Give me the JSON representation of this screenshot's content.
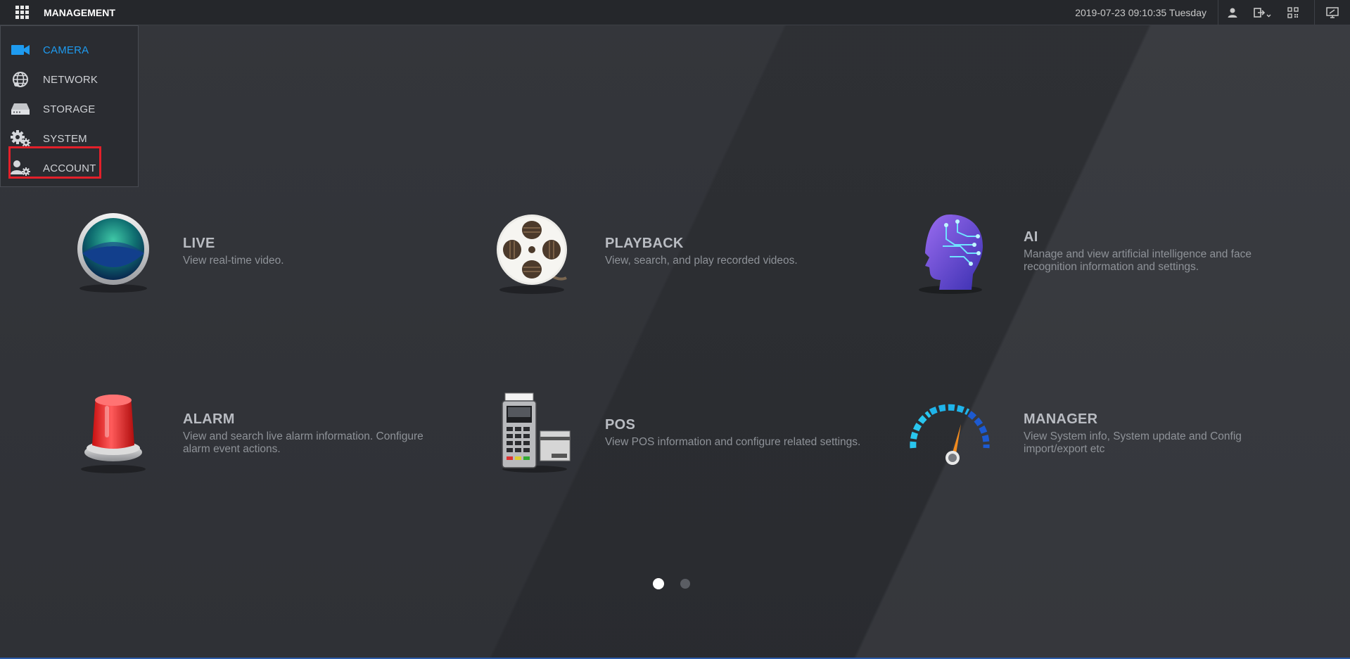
{
  "header": {
    "title": "MANAGEMENT",
    "datetime": "2019-07-23 09:10:35 Tuesday",
    "icons": [
      "grid-menu-icon",
      "user-icon",
      "logout-icon",
      "qr-code-icon",
      "monitor-icon"
    ]
  },
  "menu": {
    "items": [
      {
        "label": "CAMERA",
        "icon": "camera-icon",
        "active": true
      },
      {
        "label": "NETWORK",
        "icon": "network-globe-icon",
        "active": false
      },
      {
        "label": "STORAGE",
        "icon": "hard-drive-icon",
        "active": false
      },
      {
        "label": "SYSTEM",
        "icon": "gears-icon",
        "active": false,
        "highlighted": true
      },
      {
        "label": "ACCOUNT",
        "icon": "user-gear-icon",
        "active": false
      }
    ],
    "active_color": "#1e9bf0",
    "highlight_color": "#e3202a"
  },
  "tiles": [
    {
      "title": "LIVE",
      "description": "View real-time video.",
      "icon": "live-lens-icon"
    },
    {
      "title": "PLAYBACK",
      "description": "View, search, and play recorded videos.",
      "icon": "film-reel-icon"
    },
    {
      "title": "AI",
      "description": "Manage and view artificial intelligence and face recognition information and settings.",
      "icon": "ai-head-icon"
    },
    {
      "title": "ALARM",
      "description": "View and search live alarm information. Configure alarm event actions.",
      "icon": "alarm-siren-icon"
    },
    {
      "title": "POS",
      "description": "View POS information and configure related settings.",
      "icon": "pos-terminal-icon"
    },
    {
      "title": "MANAGER",
      "description": "View System info, System update and Config import/export etc",
      "icon": "gauge-icon"
    }
  ],
  "pager": {
    "pages": 2,
    "current": 1
  }
}
